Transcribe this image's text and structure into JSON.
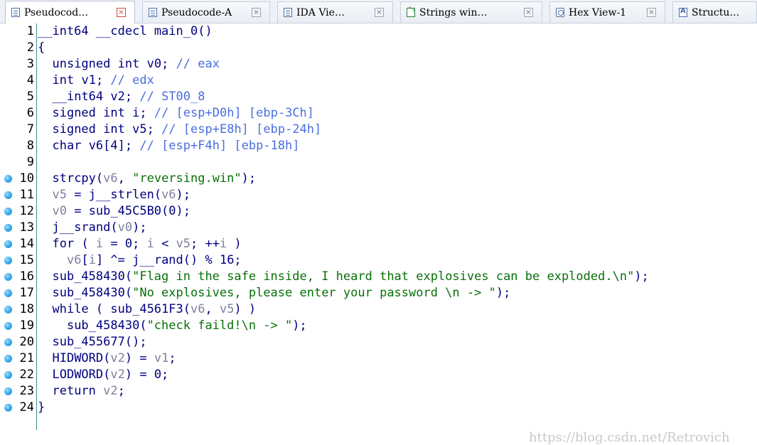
{
  "tabs": [
    {
      "label": "Pseudocod…",
      "icon": "pseudocode-doc-icon",
      "active": true
    },
    {
      "label": "Pseudocode-A",
      "icon": "pseudocode-doc-icon",
      "active": false
    },
    {
      "label": "IDA Vie…",
      "icon": "ida-view-icon",
      "active": false
    },
    {
      "label": "Strings win…",
      "icon": "strings-icon",
      "active": false
    },
    {
      "label": "Hex View-1",
      "icon": "hex-view-icon",
      "active": false
    },
    {
      "label": "Structu…",
      "icon": "structures-icon",
      "active": false
    }
  ],
  "close_glyph": "×",
  "lines": [
    {
      "n": "1",
      "bp": false,
      "html": "__int64 __cdecl main_0()"
    },
    {
      "n": "2",
      "bp": false,
      "html": "{"
    },
    {
      "n": "3",
      "bp": false,
      "html": "  unsigned int v0; // eax"
    },
    {
      "n": "4",
      "bp": false,
      "html": "  int v1; // edx"
    },
    {
      "n": "5",
      "bp": false,
      "html": "  __int64 v2; // ST00_8"
    },
    {
      "n": "6",
      "bp": false,
      "html": "  signed int i; // [esp+D0h] [ebp-3Ch]"
    },
    {
      "n": "7",
      "bp": false,
      "html": "  signed int v5; // [esp+E8h] [ebp-24h]"
    },
    {
      "n": "8",
      "bp": false,
      "html": "  char v6[4]; // [esp+F4h] [ebp-18h]"
    },
    {
      "n": "9",
      "bp": false,
      "html": ""
    },
    {
      "n": "10",
      "bp": true,
      "html": "  strcpy(v6, \"reversing.win\");"
    },
    {
      "n": "11",
      "bp": true,
      "html": "  v5 = j__strlen(v6);"
    },
    {
      "n": "12",
      "bp": true,
      "html": "  v0 = sub_45C5B0(0);"
    },
    {
      "n": "13",
      "bp": true,
      "html": "  j__srand(v0);"
    },
    {
      "n": "14",
      "bp": true,
      "html": "  for ( i = 0; i < v5; ++i )"
    },
    {
      "n": "15",
      "bp": true,
      "html": "    v6[i] ^= j__rand() % 16;"
    },
    {
      "n": "16",
      "bp": true,
      "html": "  sub_458430(\"Flag in the safe inside, I heard that explosives can be exploded.\\n\");"
    },
    {
      "n": "17",
      "bp": true,
      "html": "  sub_458430(\"No explosives, please enter your password \\n -> \");"
    },
    {
      "n": "18",
      "bp": true,
      "html": "  while ( sub_4561F3(v6, v5) )"
    },
    {
      "n": "19",
      "bp": true,
      "html": "    sub_458430(\"check faild!\\n -> \");"
    },
    {
      "n": "20",
      "bp": true,
      "html": "  sub_455677();"
    },
    {
      "n": "21",
      "bp": true,
      "html": "  HIDWORD(v2) = v1;"
    },
    {
      "n": "22",
      "bp": true,
      "html": "  LODWORD(v2) = 0;"
    },
    {
      "n": "23",
      "bp": true,
      "html": "  return v2;"
    },
    {
      "n": "24",
      "bp": true,
      "html": "}"
    }
  ],
  "watermark": "https://blog.csdn.net/Retrovich",
  "colors": {
    "keyword": "#000080",
    "variable": "#7f7f9f",
    "comment": "#4a6ee0",
    "string": "#087008",
    "breakpoint": "#33a6ea"
  }
}
